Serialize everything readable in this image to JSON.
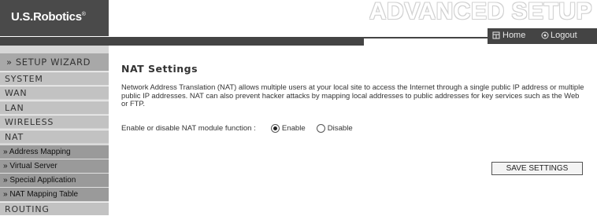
{
  "header": {
    "logo": "U.S.Robotics",
    "logo_mark": "®",
    "banner_title": "ADVANCED SETUP",
    "home_label": "Home",
    "logout_label": "Logout"
  },
  "sidebar": {
    "wizard": "» SETUP WIZARD",
    "items": [
      {
        "label": "SYSTEM"
      },
      {
        "label": "WAN"
      },
      {
        "label": "LAN"
      },
      {
        "label": "WIRELESS"
      },
      {
        "label": "NAT"
      }
    ],
    "sub_items": [
      {
        "label": "» Address Mapping"
      },
      {
        "label": "» Virtual Server"
      },
      {
        "label": "» Special Application"
      },
      {
        "label": "» NAT Mapping Table"
      }
    ],
    "last_item": "ROUTING"
  },
  "main": {
    "title": "NAT Settings",
    "description": "Network Address Translation (NAT) allows multiple users at your local site to access the Internet through a single public IP address or multiple public IP addresses. NAT can also prevent hacker attacks by mapping local addresses to public addresses for key services such as the Web or FTP.",
    "nat_label": "Enable or disable NAT module function :",
    "enable_label": "Enable",
    "disable_label": "Disable",
    "nat_enabled": true,
    "save_label": "SAVE SETTINGS"
  },
  "colors": {
    "dark_bar": "#444444",
    "sidebar_bg": "#d6d6d6",
    "menu_bg": "#c2c2c2",
    "submenu_bg": "#9a9a9a",
    "wizard_bg": "#a8a8a8"
  },
  "icons": {
    "home": "home-icon",
    "logout": "logout-icon"
  }
}
